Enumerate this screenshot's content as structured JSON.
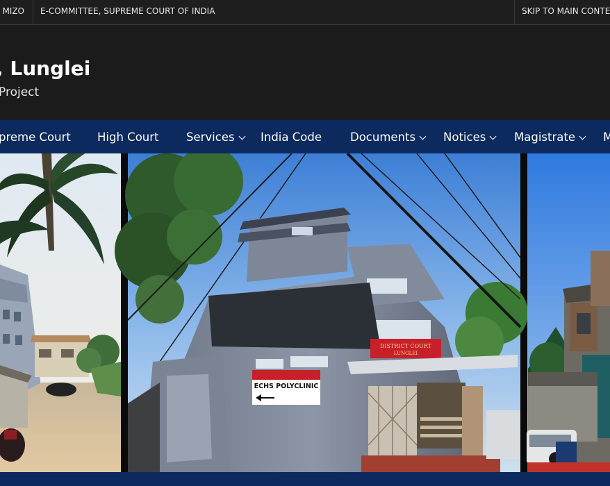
{
  "topbar": {
    "language": "MIZO",
    "ecommittee": "E-COMMITTEE, SUPREME COURT OF INDIA",
    "skip": "SKIP TO MAIN CONTENT"
  },
  "header": {
    "title": ", Lunglei",
    "subtitle": "Project"
  },
  "nav": {
    "items": [
      {
        "label": "preme Court",
        "dropdown": false
      },
      {
        "label": "High Court",
        "dropdown": false
      },
      {
        "label": "Services",
        "dropdown": true
      },
      {
        "label": "India Code",
        "dropdown": false
      },
      {
        "label": "Documents",
        "dropdown": true
      },
      {
        "label": "Notices",
        "dropdown": true
      },
      {
        "label": "Magistrate",
        "dropdown": true
      },
      {
        "label": "M",
        "dropdown": false
      }
    ]
  },
  "banner": {
    "sign_polyclinic": "ECHS POLYCLINIC",
    "sign_court": "DISTRICT COURT LUNGLEI"
  },
  "colors": {
    "nav_bg": "#0d2a5e",
    "topbar_bg": "#1e1e1e",
    "header_bg": "#1b1b1b",
    "sign_red": "#c8202a"
  },
  "icons": [
    "chevron-down-icon",
    "arrow-left-icon"
  ]
}
